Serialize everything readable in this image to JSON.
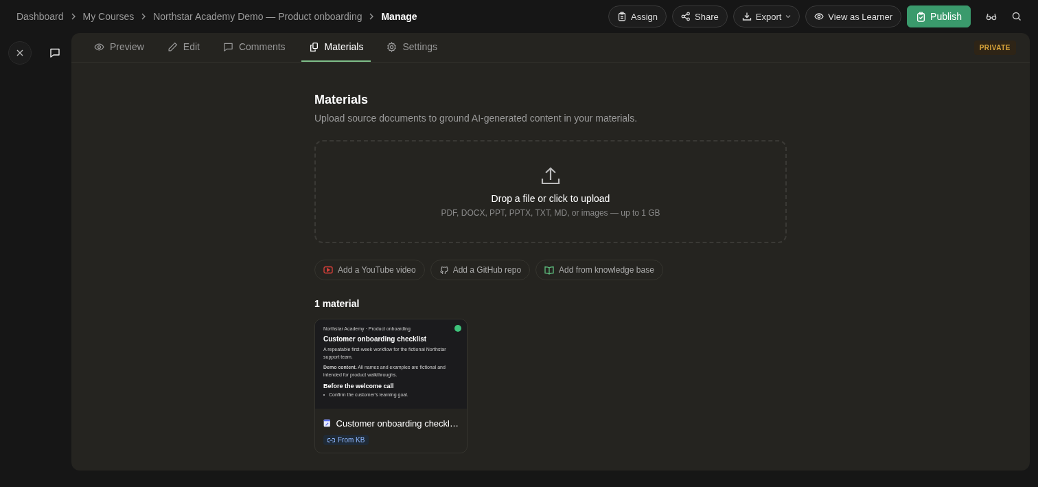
{
  "breadcrumbs": [
    {
      "label": "Dashboard",
      "current": false
    },
    {
      "label": "My Courses",
      "current": false
    },
    {
      "label": "Northstar Academy Demo — Product onboarding",
      "current": false
    },
    {
      "label": "Manage",
      "current": true
    }
  ],
  "actions": [
    {
      "label": "Assign",
      "kind": "assign"
    },
    {
      "label": "Share",
      "kind": "share"
    },
    {
      "label": "Export",
      "kind": "export"
    },
    {
      "label": "View as Learner",
      "kind": "view"
    },
    {
      "label": "Publish",
      "kind": "publish"
    }
  ],
  "tabs": [
    {
      "label": "Preview",
      "kind": "preview",
      "selected": false
    },
    {
      "label": "Edit",
      "kind": "edit",
      "selected": false
    },
    {
      "label": "Comments",
      "kind": "comments",
      "selected": false
    },
    {
      "label": "Materials",
      "kind": "materials",
      "selected": true
    },
    {
      "label": "Settings",
      "kind": "settings",
      "selected": false
    }
  ],
  "visibility_badge": "PRIVATE",
  "heading": "Materials",
  "description": "Upload source documents to ground AI-generated content in your materials.",
  "upload": {
    "title": "Drop a file or click to upload",
    "hint": "PDF, DOCX, PPT, PPTX, TXT, MD, or images — up to 1 GB"
  },
  "sources": [
    {
      "label": "Add a YouTube video",
      "kind": "youtube"
    },
    {
      "label": "Add a GitHub repo",
      "kind": "github"
    },
    {
      "label": "Add from knowledge base",
      "kind": "kb"
    }
  ],
  "count": "1 material",
  "materials": [
    {
      "name": "Customer onboarding checkl…",
      "tag": "From KB",
      "color": "#3ec27a",
      "preview": {
        "eyebrow": "Northstar Academy · Product onboarding",
        "title": "Customer onboarding checklist",
        "intro": "A repeatable first-week workflow for the fictional Northstar support team.",
        "note": "**Demo content.** All names and examples are fictional and intended for product walkthroughs.",
        "section": "Before the welcome call",
        "bullets": [
          "Confirm the customer's learning goal."
        ]
      }
    }
  ]
}
